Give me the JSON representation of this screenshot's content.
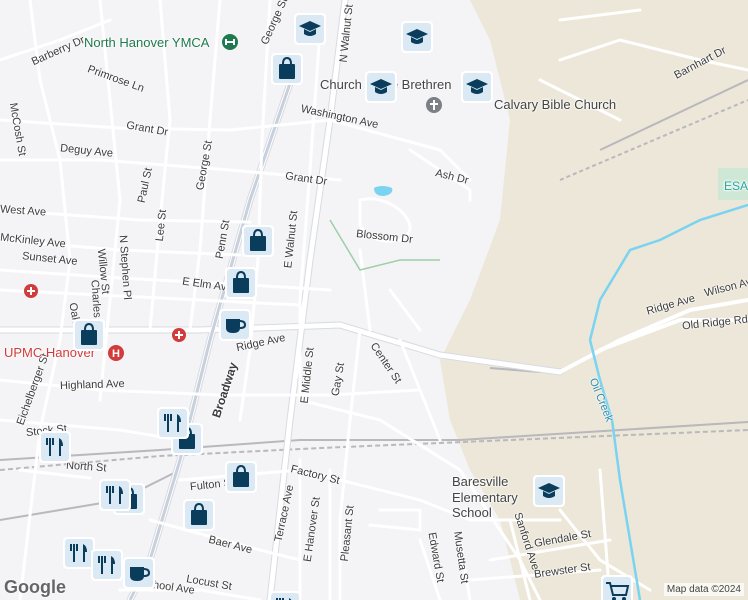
{
  "map": {
    "attribution": "Map data ©2024",
    "logo": "Google",
    "pois": {
      "ymca": "North Hanover YMCA",
      "brethren": "Church of the Brethren",
      "calvary": "Calvary Bible Church",
      "upmc": "UPMC Hanover",
      "elementary": "Baresville Elementary School",
      "esab": "ESAB"
    },
    "streets": {
      "barberry": "Barberry Dr",
      "primrose": "Primrose Ln",
      "george1": "George St",
      "george2": "George St",
      "walnut1": "N Walnut St",
      "walnut2": "E Walnut St",
      "mccosh": "McCosh St",
      "grant_dr1": "Grant Dr",
      "grant_dr2": "Grant Dr",
      "deguy": "Deguy Ave",
      "washington": "Washington Ave",
      "ash": "Ash Dr",
      "barnhart": "Barnhart Dr",
      "paul": "Paul St",
      "west": "West Ave",
      "mckinley": "McKinley Ave",
      "lee": "Lee St",
      "penn": "Penn St",
      "blossom": "Blossom Dr",
      "sunset": "Sunset Ave",
      "stephen": "N Stephen Pl",
      "willow": "Willow St",
      "elm": "E Elm Ave",
      "wilson": "Wilson Ave",
      "ridge1": "Ridge Ave",
      "ridge2": "Ridge Ave",
      "old_ridge": "Old Ridge Rd",
      "oak": "Oak St",
      "charles": "Charles St",
      "broadway": "Broadway",
      "middle": "E Middle St",
      "gay": "Gay St",
      "center": "Center St",
      "highland": "Highland Ave",
      "eichelberger": "Eichelberger St",
      "stock": "Stock St",
      "north": "North St",
      "fulton": "Fulton St",
      "factory": "Factory St",
      "terrace": "Terrace Ave",
      "e_hanover": "E Hanover St",
      "pleasant": "Pleasant St",
      "baer": "Baer Ave",
      "locust": "Locust St",
      "school": "School Ave",
      "edward": "Edward St",
      "musetta": "Musetta St",
      "sanford": "Sanford Ave",
      "glendale": "Glendale St",
      "brewster": "Brewster St",
      "oil_creek": "Oil Creek"
    },
    "icon_names": [
      "school-icon",
      "shopping-bag-icon",
      "cafe-icon",
      "restaurant-icon",
      "hospital-icon",
      "grocery-cart-icon",
      "church-icon",
      "fitness-icon"
    ],
    "colors": {
      "background": "#f4f3f6",
      "road": "#ffffff",
      "road_casing": "#d7dbe3",
      "arterial": "#c8d0dc",
      "railway": "#b8b8bd",
      "water": "#7ad3f0",
      "industrial": "#ece7d8",
      "park": "#cfe8d6",
      "pin": "#0a3d5c",
      "pin_border": "#ffffff",
      "pin_inner": "#dbe9f4",
      "poi_green": "#1e7a4e",
      "poi_red": "#d23b3b"
    }
  }
}
